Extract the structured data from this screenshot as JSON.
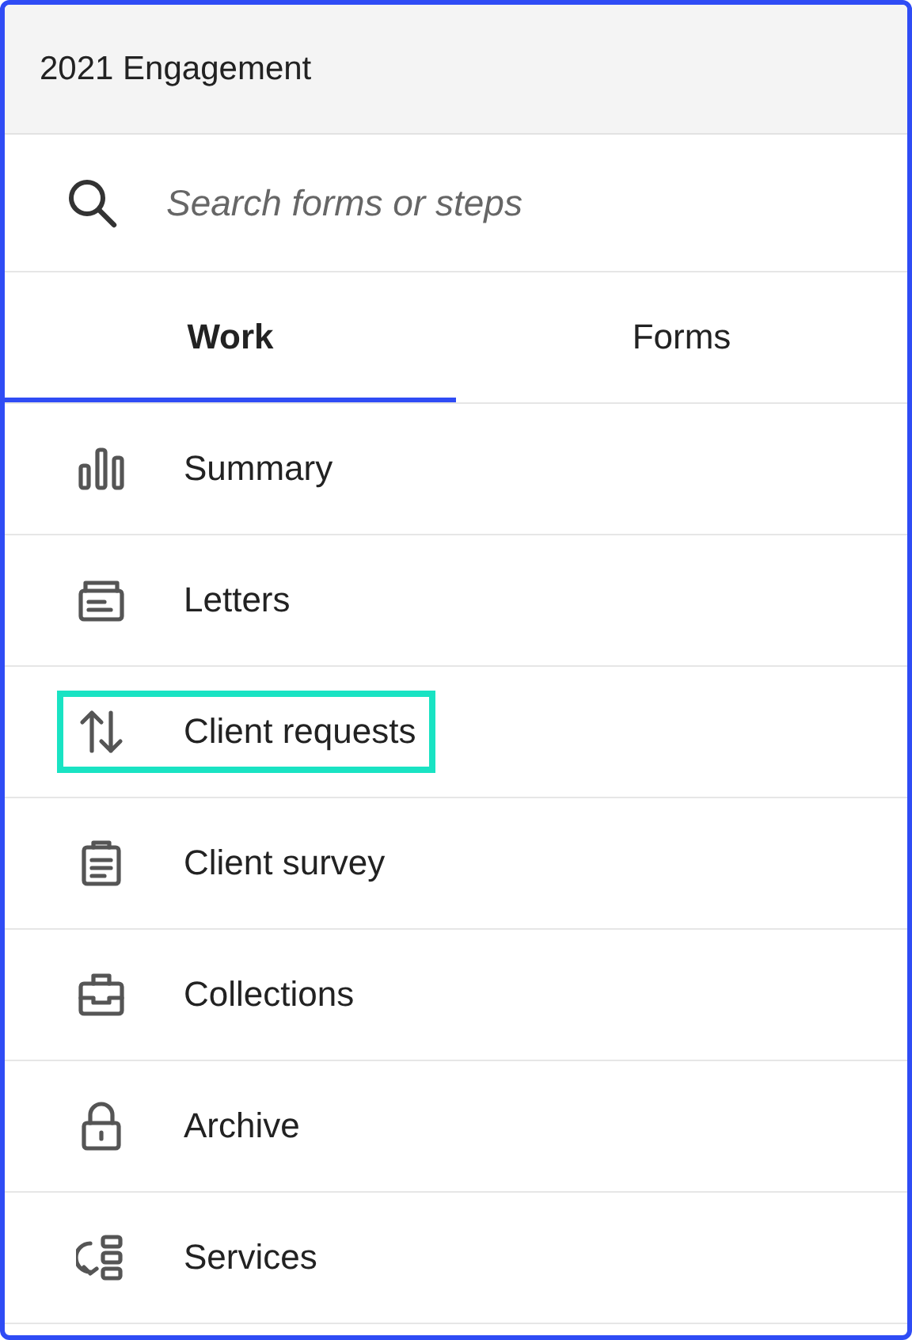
{
  "header": {
    "title": "2021 Engagement"
  },
  "search": {
    "placeholder": "Search forms or steps"
  },
  "tabs": [
    {
      "label": "Work",
      "selected": true
    },
    {
      "label": "Forms",
      "selected": false
    }
  ],
  "items": [
    {
      "label": "Summary",
      "kind": "summary",
      "highlighted": false
    },
    {
      "label": "Letters",
      "kind": "letters",
      "highlighted": false
    },
    {
      "label": "Client requests",
      "kind": "requests",
      "highlighted": true
    },
    {
      "label": "Client survey",
      "kind": "survey",
      "highlighted": false
    },
    {
      "label": "Collections",
      "kind": "collections",
      "highlighted": false
    },
    {
      "label": "Archive",
      "kind": "archive",
      "highlighted": false
    },
    {
      "label": "Services",
      "kind": "services",
      "highlighted": false
    }
  ]
}
